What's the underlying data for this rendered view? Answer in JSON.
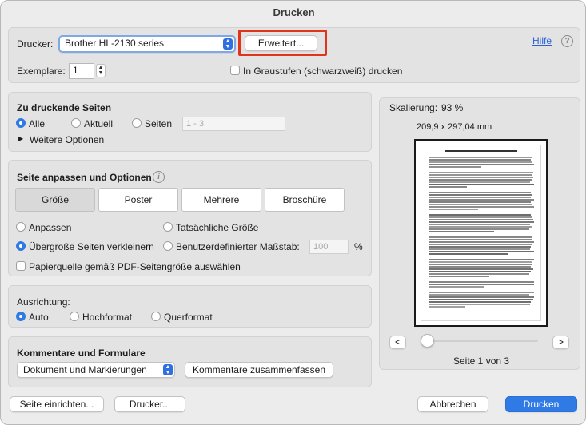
{
  "window": {
    "title": "Drucken"
  },
  "printer": {
    "label": "Drucker:",
    "selected": "Brother HL-2130 series",
    "advanced_button": "Erweitert...",
    "help_link": "Hilfe",
    "help_icon": "question-mark-icon"
  },
  "copies": {
    "label": "Exemplare:",
    "value": "1",
    "grayscale_label": "In Graustufen (schwarzweiß) drucken"
  },
  "pages": {
    "title": "Zu druckende Seiten",
    "option_all": "Alle",
    "option_current": "Aktuell",
    "option_pages": "Seiten",
    "pages_placeholder": "1 - 3",
    "more_options": "Weitere Optionen"
  },
  "fit": {
    "title": "Seite anpassen und Optionen",
    "info_icon": "info-icon",
    "tabs": [
      "Größe",
      "Poster",
      "Mehrere",
      "Broschüre"
    ],
    "active_tab": "Größe",
    "option_fit": "Anpassen",
    "option_actual": "Tatsächliche Größe",
    "option_shrink": "Übergroße Seiten verkleinern",
    "option_custom": "Benutzerdefinierter Maßstab:",
    "scale_value": "100",
    "scale_unit": "%",
    "paper_source": "Papierquelle gemäß PDF-Seitengröße auswählen"
  },
  "orientation": {
    "title": "Ausrichtung:",
    "option_auto": "Auto",
    "option_portrait": "Hochformat",
    "option_landscape": "Querformat"
  },
  "comments": {
    "title": "Kommentare und Formulare",
    "selected": "Dokument und Markierungen",
    "summarize_button": "Kommentare zusammenfassen"
  },
  "preview": {
    "scaling_label": "Skalierung:",
    "scaling_value": "93 %",
    "dimensions": "209,9 x 297,04 mm",
    "prev_button": "<",
    "next_button": ">",
    "page_indicator": "Seite 1 von 3",
    "slider_position": 0
  },
  "footer": {
    "page_setup": "Seite einrichten...",
    "printer_button": "Drucker...",
    "cancel": "Abbrechen",
    "print": "Drucken"
  },
  "colors": {
    "accent": "#2f7ae5",
    "highlight": "#e0341b",
    "link": "#2b63d8"
  }
}
